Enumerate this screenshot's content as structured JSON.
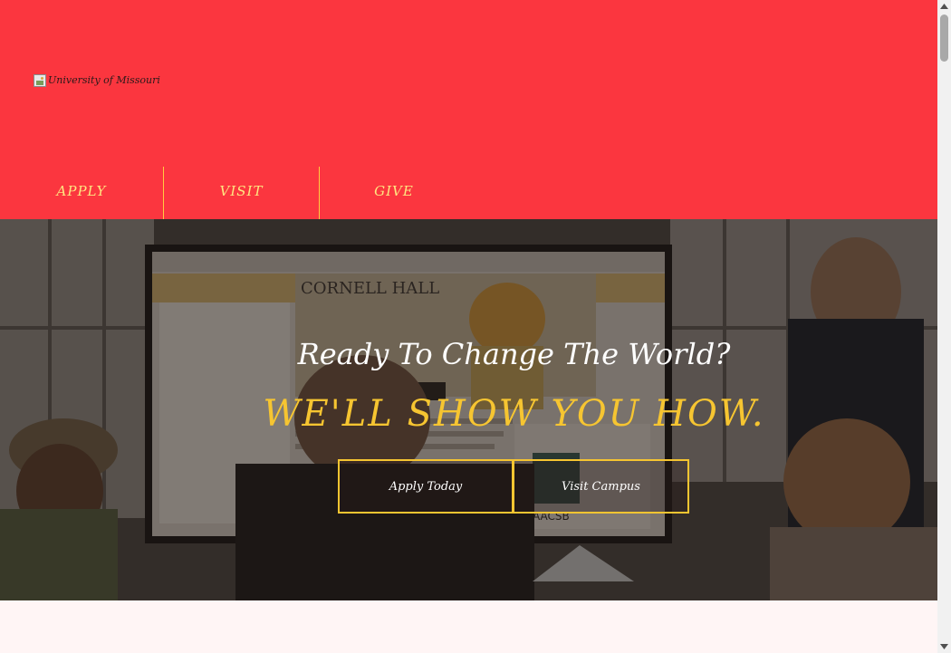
{
  "header": {
    "logo_alt": "University of Missouri",
    "background_color": "#fb363f"
  },
  "nav": {
    "items": [
      {
        "label": "APPLY"
      },
      {
        "label": "VISIT"
      },
      {
        "label": "GIVE"
      }
    ],
    "text_color": "#ffe680",
    "divider_color": "#ffcc40"
  },
  "hero": {
    "heading": "Ready To Change The World?",
    "subheading": "WE'LL SHOW YOU HOW.",
    "subheading_color": "#f6c531",
    "buttons": [
      {
        "label": "Apply Today"
      },
      {
        "label": "Visit Campus"
      }
    ],
    "photo_screen": {
      "title": "CORNELL HALL",
      "badge": "AACSB"
    }
  },
  "icons": {
    "logo": "broken-image-icon",
    "scroll_up": "triangle-up-icon",
    "scroll_down": "triangle-down-icon"
  }
}
